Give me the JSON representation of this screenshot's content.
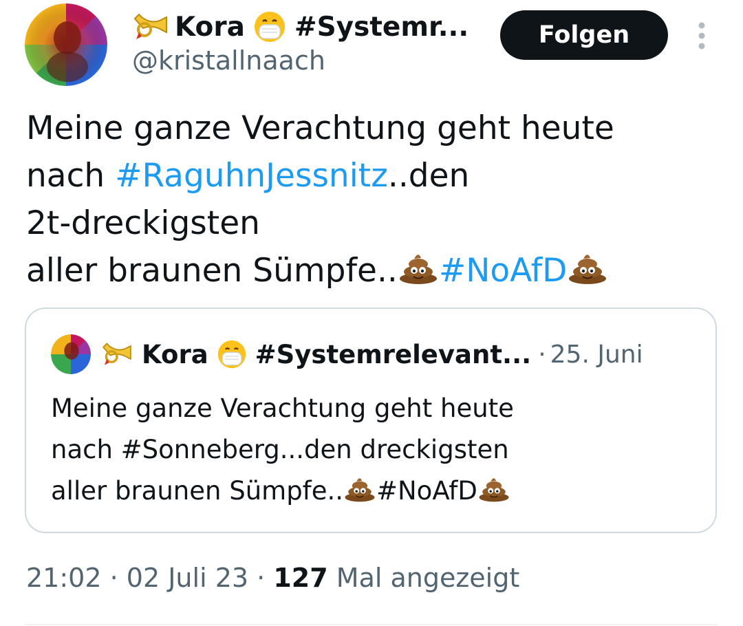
{
  "author": {
    "display_name_prefix": "Kora",
    "display_name_suffix": "#Systemr...",
    "handle": "@kristallnaach",
    "avatar_icon": "rainbow-avatar-icon",
    "name_icons": [
      "postal-horn-icon",
      "mask-face-emoji-icon"
    ]
  },
  "follow_button": {
    "label": "Folgen"
  },
  "more_button": {
    "icon": "more-vertical-icon"
  },
  "tweet": {
    "line1": "Meine ganze Verachtung geht heute",
    "line2_prefix": "nach ",
    "line2_hashtag": "#RaguhnJessnitz",
    "line2_suffix": "..den",
    "line3": "2t-dreckigsten",
    "line4_prefix": "aller braunen Sümpfe..",
    "line4_hashtag": "#NoAfD",
    "emoji": "pile-of-poo-emoji-icon"
  },
  "quoted_tweet": {
    "display_name_prefix": "Kora",
    "display_name_suffix": "#Systemrelevant...",
    "separator": "·",
    "date": "25. Juni",
    "line1": "Meine ganze Verachtung geht heute",
    "line2": "nach #Sonneberg...den dreckigsten",
    "line3_prefix": "aller braunen Sümpfe..",
    "line3_hashtag": "#NoAfD"
  },
  "meta": {
    "time": "21:02",
    "separator": "·",
    "date": "02 Juli 23",
    "views_count": "127",
    "views_label": "Mal angezeigt"
  },
  "colors": {
    "text": "#0f1419",
    "secondary": "#536471",
    "link": "#1d9bf0",
    "button_bg": "#0f1419",
    "border": "#cfd9de"
  }
}
